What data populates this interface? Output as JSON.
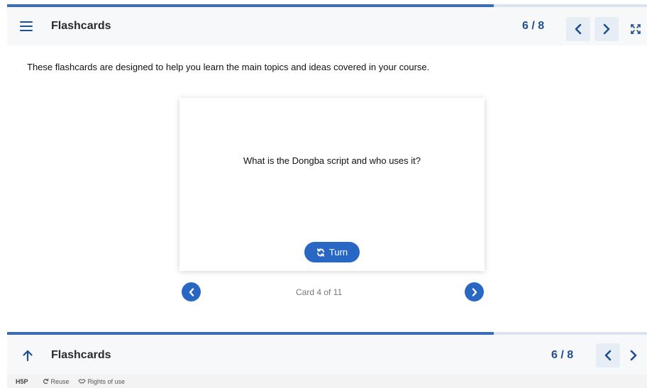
{
  "header": {
    "title": "Flashcards",
    "counter": "6 / 8",
    "progress_fraction": 0.76
  },
  "content": {
    "intro": "These flashcards are designed to help you learn the main topics and ideas covered in your course.",
    "card": {
      "question": "What is the Dongba script and who uses it?",
      "turn_label": "Turn"
    },
    "card_count": "Card 4 of 11"
  },
  "footer_bar": {
    "title": "Flashcards",
    "counter": "6 / 8",
    "progress_fraction": 0.76
  },
  "footer": {
    "brand": "H5P",
    "reuse_label": "Reuse",
    "rights_label": "Rights of use"
  },
  "colors": {
    "accent": "#2867c4",
    "bar_fill": "#3b6db4",
    "bar_track": "#dbe3ee"
  },
  "icons": [
    "menu-icon",
    "chevron-left-icon",
    "chevron-right-icon",
    "fullscreen-icon",
    "refresh-icon",
    "arrow-up-icon",
    "handshake-icon"
  ]
}
